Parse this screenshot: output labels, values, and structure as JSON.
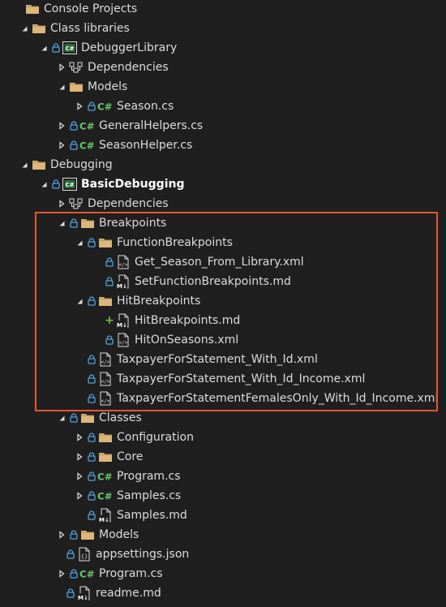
{
  "colors": {
    "background": "#1f1f1f",
    "text": "#dcdcdc",
    "folder": "#dcb67a",
    "csharp": "#68c96b",
    "lock": "#4fa3e0",
    "highlight": "#e4572e"
  },
  "tree": [
    {
      "label": "Console Projects",
      "icon": "folder-icon",
      "chevron": "none",
      "lock": false,
      "bold": false
    },
    {
      "label": "Class libraries",
      "icon": "folder-icon",
      "chevron": "expanded",
      "lock": false,
      "bold": false
    },
    {
      "label": "DebuggerLibrary",
      "icon": "csharp-project-icon",
      "chevron": "expanded",
      "lock": true,
      "bold": false
    },
    {
      "label": "Dependencies",
      "icon": "dependencies-icon",
      "chevron": "collapsed",
      "lock": false,
      "bold": false
    },
    {
      "label": "Models",
      "icon": "folder-icon",
      "chevron": "expanded",
      "lock": false,
      "bold": false
    },
    {
      "label": "Season.cs",
      "icon": "csharp-file-icon",
      "chevron": "collapsed",
      "lock": true,
      "bold": false
    },
    {
      "label": "GeneralHelpers.cs",
      "icon": "csharp-file-icon",
      "chevron": "collapsed",
      "lock": true,
      "bold": false
    },
    {
      "label": "SeasonHelper.cs",
      "icon": "csharp-file-icon",
      "chevron": "collapsed",
      "lock": true,
      "bold": false
    },
    {
      "label": "Debugging",
      "icon": "folder-icon",
      "chevron": "expanded",
      "lock": false,
      "bold": false
    },
    {
      "label": "BasicDebugging",
      "icon": "csharp-project-icon",
      "chevron": "expanded",
      "lock": true,
      "bold": true
    },
    {
      "label": "Dependencies",
      "icon": "dependencies-icon",
      "chevron": "collapsed",
      "lock": false,
      "bold": false
    },
    {
      "label": "Breakpoints",
      "icon": "folder-icon",
      "chevron": "expanded",
      "lock": true,
      "bold": false
    },
    {
      "label": "FunctionBreakpoints",
      "icon": "folder-icon",
      "chevron": "expanded",
      "lock": true,
      "bold": false
    },
    {
      "label": "Get_Season_From_Library.xml",
      "icon": "xml-file-icon",
      "chevron": "none",
      "lock": true,
      "bold": false
    },
    {
      "label": "SetFunctionBreakpoints.md",
      "icon": "markdown-file-icon",
      "chevron": "none",
      "lock": true,
      "bold": false
    },
    {
      "label": "HitBreakpoints",
      "icon": "folder-icon",
      "chevron": "expanded",
      "lock": true,
      "bold": false
    },
    {
      "label": "HitBreakpoints.md",
      "icon": "markdown-file-icon",
      "chevron": "none",
      "lock": false,
      "plus": true,
      "bold": false
    },
    {
      "label": "HitOnSeasons.xml",
      "icon": "xml-file-icon",
      "chevron": "none",
      "lock": true,
      "bold": false
    },
    {
      "label": "TaxpayerForStatement_With_Id.xml",
      "icon": "xml-file-icon",
      "chevron": "none",
      "lock": true,
      "bold": false
    },
    {
      "label": "TaxpayerForStatement_With_Id_Income.xml",
      "icon": "xml-file-icon",
      "chevron": "none",
      "lock": true,
      "bold": false
    },
    {
      "label": "TaxpayerForStatementFemalesOnly_With_Id_Income.xml",
      "icon": "xml-file-icon",
      "chevron": "none",
      "lock": true,
      "bold": false
    },
    {
      "label": "Classes",
      "icon": "folder-icon",
      "chevron": "expanded",
      "lock": true,
      "bold": false
    },
    {
      "label": "Configuration",
      "icon": "folder-icon",
      "chevron": "collapsed",
      "lock": true,
      "bold": false
    },
    {
      "label": "Core",
      "icon": "folder-icon",
      "chevron": "collapsed",
      "lock": true,
      "bold": false
    },
    {
      "label": "Program.cs",
      "icon": "csharp-file-icon",
      "chevron": "collapsed",
      "lock": true,
      "bold": false
    },
    {
      "label": "Samples.cs",
      "icon": "csharp-file-icon",
      "chevron": "collapsed",
      "lock": true,
      "bold": false
    },
    {
      "label": "Samples.md",
      "icon": "markdown-file-icon",
      "chevron": "none",
      "lock": true,
      "bold": false
    },
    {
      "label": "Models",
      "icon": "folder-icon",
      "chevron": "collapsed",
      "lock": true,
      "bold": false
    },
    {
      "label": "appsettings.json",
      "icon": "json-file-icon",
      "chevron": "none",
      "lock": true,
      "bold": false
    },
    {
      "label": "Program.cs",
      "icon": "csharp-file-icon",
      "chevron": "collapsed",
      "lock": true,
      "bold": false
    },
    {
      "label": "readme.md",
      "icon": "markdown-file-icon",
      "chevron": "none",
      "lock": true,
      "bold": false
    }
  ]
}
